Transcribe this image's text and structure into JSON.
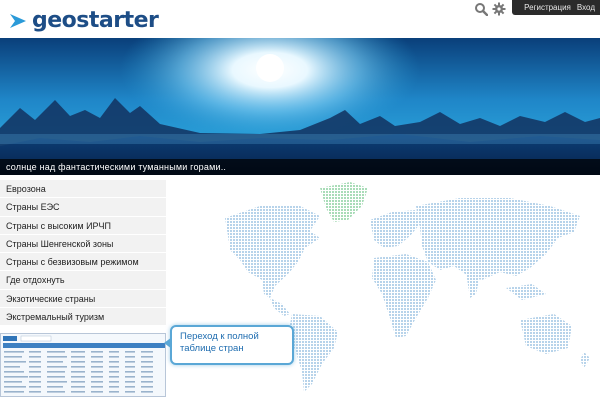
{
  "header": {
    "logo_text": "geostarter",
    "register_label": "Регистрация",
    "login_label": "Вход",
    "icons": [
      "search-icon",
      "gear-icon"
    ]
  },
  "banner": {
    "caption": "солнце над фантастическими туманными горами.."
  },
  "sidebar": {
    "items": [
      {
        "label": "Еврозона"
      },
      {
        "label": "Страны ЕЭС"
      },
      {
        "label": "Страны с высоким ИРЧП"
      },
      {
        "label": "Страны Шенгенской зоны"
      },
      {
        "label": "Страны с безвизовым режимом"
      },
      {
        "label": "Где отдохнуть"
      },
      {
        "label": "Экзотические страны"
      },
      {
        "label": "Экстремальный туризм"
      }
    ]
  },
  "callout": {
    "text": "Переход к полной таблице стран"
  },
  "colors": {
    "brand": "#1d4d86",
    "map_land": "#b7d3ea",
    "map_highlight": "#a9dcb8",
    "callout_border": "#5aa7d6"
  }
}
